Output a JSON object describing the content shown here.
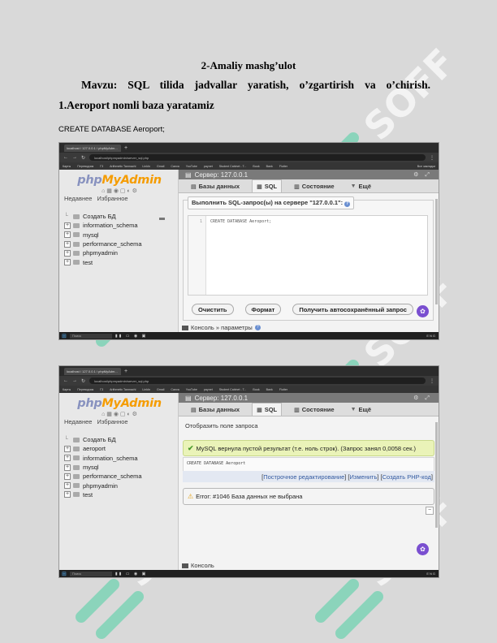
{
  "document": {
    "title": "2-Amaliy mashg’ulot",
    "topic": "Mavzu: SQL tilida jadvallar yaratish, o’zgartirish va o’chirish.",
    "step": "1.Aeroport nomli baza yaratamiz",
    "sql_statement": "CREATE DATABASE Aeroport;"
  },
  "watermark": {
    "text": "SOFF",
    "color": "#2dcf97"
  },
  "screenshot1": {
    "browser_tab": "localhost / 127.0.0.1 / phpMyAdm...",
    "url": "localhost/phpmyadmin/server_sql.php",
    "bookmarks": [
      "Карты",
      "Переводчик",
      "Г3",
      "Arithmetic Tanmachi",
      "LinkIn",
      "Gmail",
      "Canva",
      "YouTube",
      "paynet",
      "Student Cabinet - T...",
      "Book",
      "Bank",
      "Flutter",
      "Все закладки"
    ],
    "logo_php": "php",
    "logo_myadmin": "MyAdmin",
    "nav_tabs": [
      "Недавнее",
      "Избранное"
    ],
    "tree": [
      "Создать БД",
      "information_schema",
      "mysql",
      "performance_schema",
      "phpmyadmin",
      "test"
    ],
    "server": "Сервер: 127.0.0.1",
    "menu": [
      "Базы данных",
      "SQL",
      "Состояние",
      "Ещё"
    ],
    "query_legend": "Выполнить SQL-запрос(ы) на сервере \"127.0.0.1\":",
    "line_number": "1",
    "code": "CREATE DATABASE Aeroport;",
    "buttons": [
      "Очистить",
      "Формат",
      "Получить автосохранённый запрос"
    ],
    "console": "Консоль » параметры",
    "taskbar_search": "Поиск",
    "taskbar_tray": "ENG"
  },
  "screenshot2": {
    "browser_tab": "localhost / 127.0.0.1 / phpMyAdm...",
    "url": "localhost/phpmyadmin/server_sql.php",
    "bookmarks": [
      "Карты",
      "Переводчик",
      "Г3",
      "Arithmetic Tanmachi",
      "LinkIn",
      "Gmail",
      "Canva",
      "YouTube",
      "paynet",
      "Student Cabinet - T...",
      "Book",
      "Bank",
      "Flutter"
    ],
    "logo_php": "php",
    "logo_myadmin": "MyAdmin",
    "nav_tabs": [
      "Недавнее",
      "Избранное"
    ],
    "tree": [
      "Создать БД",
      "aeroport",
      "information_schema",
      "mysql",
      "performance_schema",
      "phpmyadmin",
      "test"
    ],
    "server": "Сервер: 127.0.0.1",
    "menu": [
      "Базы данных",
      "SQL",
      "Состояние",
      "Ещё"
    ],
    "toggle_query": "Отобразить поле запроса",
    "success": "MySQL вернула пустой результат (т.е. ноль строк). (Запрос занял 0,0058 сек.)",
    "sql_output": "CREATE DATABASE Aeroport",
    "links": [
      "Построчное редактирование",
      "Изменить",
      "Создать PHP-код"
    ],
    "error": "Error: #1046 База данных не выбрана",
    "console": "Консоль",
    "taskbar_search": "Поиск",
    "taskbar_tray": "ENG"
  }
}
